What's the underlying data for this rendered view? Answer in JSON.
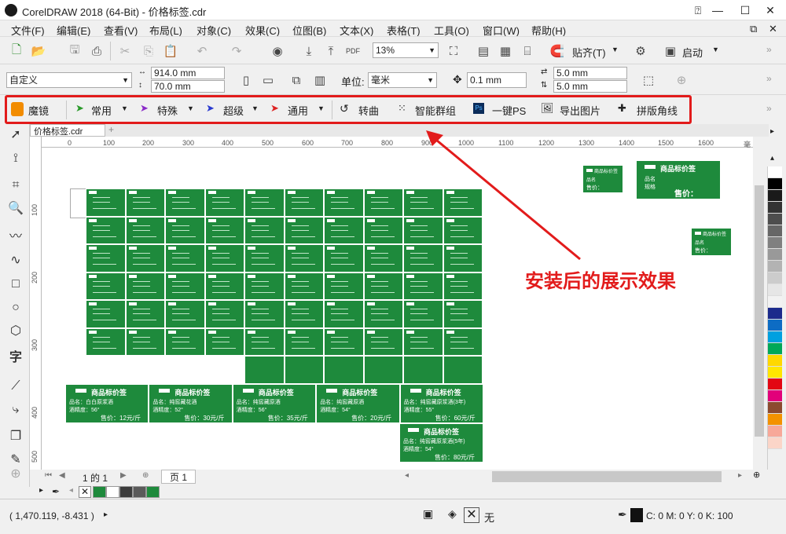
{
  "window": {
    "title": "CorelDRAW 2018 (64-Bit) - 价格标签.cdr"
  },
  "menu": [
    "文件(F)",
    "编辑(E)",
    "查看(V)",
    "布局(L)",
    "对象(C)",
    "效果(C)",
    "位图(B)",
    "文本(X)",
    "表格(T)",
    "工具(O)",
    "窗口(W)",
    "帮助(H)"
  ],
  "stdbar": {
    "zoom": "13%",
    "snap_label": "贴齐(T)",
    "launch_label": "启动"
  },
  "propbar": {
    "page_preset": "自定义",
    "width": "914.0 mm",
    "height": "70.0 mm",
    "units_label": "单位:",
    "units": "毫米",
    "nudge": "0.1 mm",
    "dup_x": "5.0 mm",
    "dup_y": "5.0 mm"
  },
  "magicbar": {
    "brand": "魔镜",
    "common": "常用",
    "special": "特殊",
    "super": "超级",
    "general": "通用",
    "convert": "转曲",
    "smart_group": "智能群组",
    "ps_label": "一键PS",
    "export": "导出图片",
    "crop_marks": "拼版角线"
  },
  "doc": {
    "tab": "价格标签.cdr",
    "page_nav": "1 的 1",
    "page_tab": "页 1"
  },
  "ruler": {
    "h": [
      "0",
      "100",
      "200",
      "300",
      "400",
      "500",
      "600",
      "700",
      "800",
      "900",
      "1000",
      "1100",
      "1200",
      "1300",
      "1400",
      "1500",
      "1600"
    ],
    "v": [
      "100",
      "200",
      "300",
      "400",
      "500"
    ],
    "unit": "毫米"
  },
  "labels": {
    "header": "商品标价签",
    "name_prefix": "品名:",
    "price_prefix": "售价:",
    "degree_prefix": "酒精度:",
    "big": [
      {
        "name": "品名：白白原浆酒",
        "degree": "酒精度：56°",
        "price": "售价：12元/斤"
      },
      {
        "name": "品名：纯窖藏花酒",
        "degree": "酒精度：52°",
        "price": "售价：30元/斤"
      },
      {
        "name": "品名：纯窖藏原酒",
        "degree": "酒精度：56°",
        "price": "售价：35元/斤"
      },
      {
        "name": "品名：纯窖藏原酒",
        "degree": "酒精度：54°",
        "price": "售价：20元/斤"
      },
      {
        "name": "品名：纯窖藏原浆酒(3年)",
        "degree": "酒精度：55°",
        "price": "售价：60元/斤"
      },
      {
        "name": "品名：纯窖藏原浆酒(5年)",
        "degree": "酒精度：54°",
        "price": "售价：80元/斤"
      }
    ],
    "preview_name": "品名",
    "preview_spec": "规格",
    "preview_price": "售价："
  },
  "annotation": "安装后的展示效果",
  "status": {
    "coords": "( 1,470.119, -8.431 )",
    "fill": "无",
    "outline": "C: 0 M: 0 Y: 0 K: 100"
  },
  "colors": {
    "label_green": "#1e8a3c",
    "highlight_red": "#e21b1b"
  },
  "palette": [
    "#ffffff",
    "#000000",
    "#1a1a1a",
    "#333333",
    "#4d4d4d",
    "#666666",
    "#808080",
    "#999999",
    "#b3b3b3",
    "#cccccc",
    "#e6e6e6",
    "#f2f2f2",
    "#1b2a8c",
    "#0d6cc4",
    "#00a0e0",
    "#00a859",
    "#ffd800",
    "#ffe600",
    "#e30613",
    "#e2007a",
    "#8c4a2f",
    "#f39200",
    "#f7a899",
    "#fbd5c8"
  ],
  "swatches": [
    "#1e8a3c",
    "#ffffff",
    "#3c3c3c",
    "#5a5a5a",
    "#1e8a3c"
  ]
}
